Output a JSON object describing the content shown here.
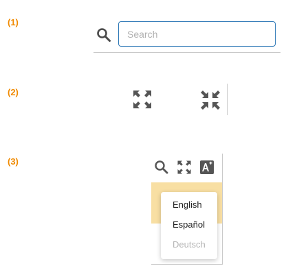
{
  "steps": {
    "one": "(1)",
    "two": "(2)",
    "three": "(3)"
  },
  "search": {
    "placeholder": "Search",
    "value": ""
  },
  "icons": {
    "search": "search-icon",
    "expand": "fullscreen-expand-icon",
    "collapse": "fullscreen-collapse-icon",
    "language": "language-icon"
  },
  "language_menu": {
    "items": [
      {
        "label": "English",
        "enabled": true
      },
      {
        "label": "Español",
        "enabled": true
      },
      {
        "label": "Deutsch",
        "enabled": false
      }
    ]
  },
  "colors": {
    "step_label": "#f08a00",
    "input_border": "#2f79b7",
    "icon": "#555555",
    "highlight_band": "#f8dfa3",
    "disabled_text": "#b5b5b5"
  }
}
